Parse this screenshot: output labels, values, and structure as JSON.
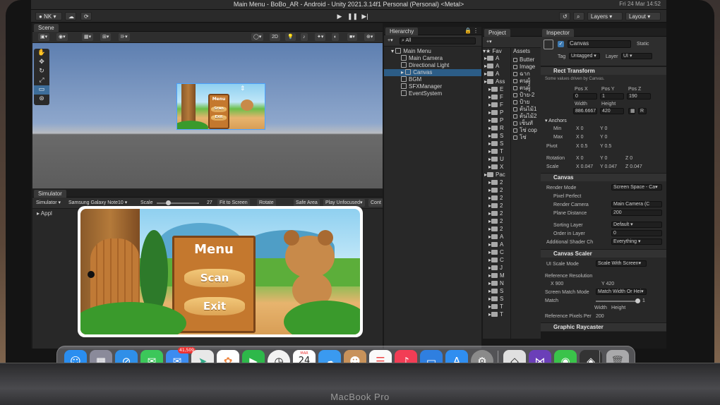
{
  "window": {
    "title": "Main Menu - BoBo_AR - Android - Unity 2021.3.14f1 Personal (Personal) <Metal>",
    "clock": "Fri 24 Mar 14:52"
  },
  "toolbar": {
    "account": "NK",
    "layers": "Layers",
    "layout": "Layout"
  },
  "scene": {
    "tab": "Scene",
    "mode_2d": "2D"
  },
  "simulator": {
    "tab": "Simulator",
    "mode": "Simulator",
    "device": "Samsung Galaxy Note10",
    "scale_label": "Scale",
    "scale_value": "27",
    "scale_fraction": 0.27,
    "fit": "Fit to Screen",
    "rotate": "Rotate",
    "safe_area": "Safe Area",
    "play_mode": "Play Unfocused",
    "control": "Cont",
    "app_label": "Appl"
  },
  "game": {
    "menu_title": "Menu",
    "scan": "Scan",
    "exit": "Exit"
  },
  "hierarchy": {
    "tab": "Hierarchy",
    "search": "All",
    "items": [
      {
        "label": "Main Menu",
        "depth": 0,
        "selected": false
      },
      {
        "label": "Main Camera",
        "depth": 1,
        "selected": false
      },
      {
        "label": "Directional Light",
        "depth": 1,
        "selected": false
      },
      {
        "label": "Canvas",
        "depth": 1,
        "selected": true
      },
      {
        "label": "BGM",
        "depth": 1,
        "selected": false
      },
      {
        "label": "SFXManager",
        "depth": 1,
        "selected": false
      },
      {
        "label": "EventSystem",
        "depth": 1,
        "selected": false
      }
    ]
  },
  "project": {
    "tab": "Project",
    "favorites": "Fav",
    "assets_path": "Assets",
    "tree": [
      "A",
      "A",
      "A",
      "Ass",
      "E",
      "F",
      "F",
      "P",
      "P",
      "R",
      "S",
      "S",
      "T",
      "U",
      "X",
      "Pac",
      "2",
      "2",
      "2",
      "2",
      "2",
      "2",
      "2",
      "A",
      "A",
      "C",
      "C",
      "J",
      "M",
      "N",
      "S",
      "S",
      "T",
      "T"
    ],
    "assets": [
      "Butter",
      "Image",
      "ฉาก",
      "ตนฺผู้",
      "ตนฺผู้",
      "ป้าย-2",
      "ป้าย",
      "ต้นไม้1",
      "ต้นไม้2",
      "เซ็นทั",
      "โซ่ cop",
      "โซ่"
    ]
  },
  "inspector": {
    "tab": "Inspector",
    "object_name": "Canvas",
    "static": "Static",
    "tag_label": "Tag",
    "tag": "Untagged",
    "layer_label": "Layer",
    "layer": "UI",
    "rect_transform": {
      "title": "Rect Transform",
      "note": "Some values driven by Canvas.",
      "pos_x_label": "Pos X",
      "pos_y_label": "Pos Y",
      "pos_z_label": "Pos Z",
      "pos_x": "0",
      "pos_y": "1",
      "pos_z": "190",
      "width_label": "Width",
      "height_label": "Height",
      "width": "886.6667",
      "height": "420",
      "anchors": "Anchors",
      "min_label": "Min",
      "max_label": "Max",
      "min_x": "0",
      "min_y": "0",
      "max_x": "0",
      "max_y": "0",
      "pivot_label": "Pivot",
      "pivot_x": "0.5",
      "pivot_y": "0.5",
      "rotation_label": "Rotation",
      "rot_x": "0",
      "rot_y": "0",
      "rot_z": "0",
      "scale_label": "Scale",
      "scale_x": "0.047",
      "scale_y": "0.047",
      "scale_z": "0.047"
    },
    "canvas": {
      "title": "Canvas",
      "render_mode_label": "Render Mode",
      "render_mode": "Screen Space - Ca",
      "pixel_perfect": "Pixel Perfect",
      "render_camera_label": "Render Camera",
      "render_camera": "Main Camera (C",
      "plane_distance_label": "Plane Distance",
      "plane_distance": "200",
      "sorting_layer_label": "Sorting Layer",
      "sorting_layer": "Default",
      "order_label": "Order in Layer",
      "order": "0",
      "shader_label": "Additional Shader Ch",
      "shader": "Everything"
    },
    "scaler": {
      "title": "Canvas Scaler",
      "ui_scale_mode_label": "UI Scale Mode",
      "ui_scale_mode": "Scale With Screen",
      "ref_res_label": "Reference Resolution",
      "ref_x": "900",
      "ref_y": "420",
      "match_mode_label": "Screen Match Mode",
      "match_mode": "Match Width Or Hei",
      "match_label": "Match",
      "match_value": "1",
      "match_fraction": 1,
      "width_label": "Width",
      "height_label": "Height",
      "ref_ppu_label": "Reference Pixels Per",
      "ref_ppu": "200"
    },
    "graphic_raycaster": "Graphic Raycaster"
  },
  "dock": {
    "mail_badge": "41,509",
    "calendar_month": "MAR",
    "calendar_day": "24",
    "apps": [
      "finder",
      "launchpad",
      "safari",
      "messages",
      "mail",
      "maps",
      "photos",
      "facetime",
      "clock",
      "calendar",
      "weather",
      "contacts",
      "reminders",
      "music",
      "keynote",
      "app-store",
      "settings",
      "unity",
      "visual-studio",
      "line",
      "unity-hub",
      "trash"
    ]
  },
  "laptop": {
    "brand": "MacBook Pro"
  }
}
